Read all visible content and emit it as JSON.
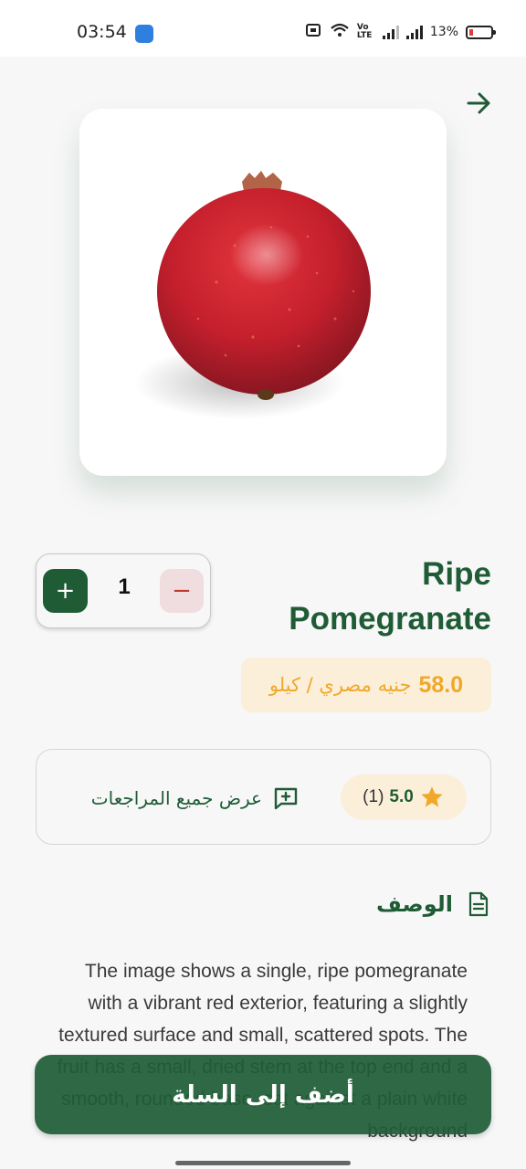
{
  "status_bar": {
    "time": "03:54",
    "network_label": "Vo LTE",
    "battery_percent": "13%",
    "battery_level": 0.13
  },
  "header": {
    "back_icon": "arrow-right-icon"
  },
  "product": {
    "image_icon": "pomegranate-image",
    "name": "Ripe Pomegranate",
    "price_value": "58.0",
    "price_unit": "جنيه مصري / كيلو",
    "quantity": "1",
    "plus_symbol": "+",
    "minus_symbol": "−"
  },
  "reviews": {
    "rating": "5.0",
    "count": "(1)",
    "view_all_label": "عرض جميع المراجعات",
    "star_icon": "star-icon",
    "review_icon": "add-comment-icon"
  },
  "description": {
    "title": "الوصف",
    "icon": "document-icon",
    "text": "The image shows a single, ripe pomegranate with a vibrant red exterior, featuring a slightly textured surface and small, scattered spots. The fruit has a small, dried stem at the top end and a smooth, rounded base, set against a plain white background"
  },
  "cart": {
    "add_label": "أضف إلى السلة"
  },
  "colors": {
    "primary": "#1f5c36",
    "accent": "#efa829",
    "accent_bg": "#fbefd9",
    "danger": "#c0392b"
  }
}
